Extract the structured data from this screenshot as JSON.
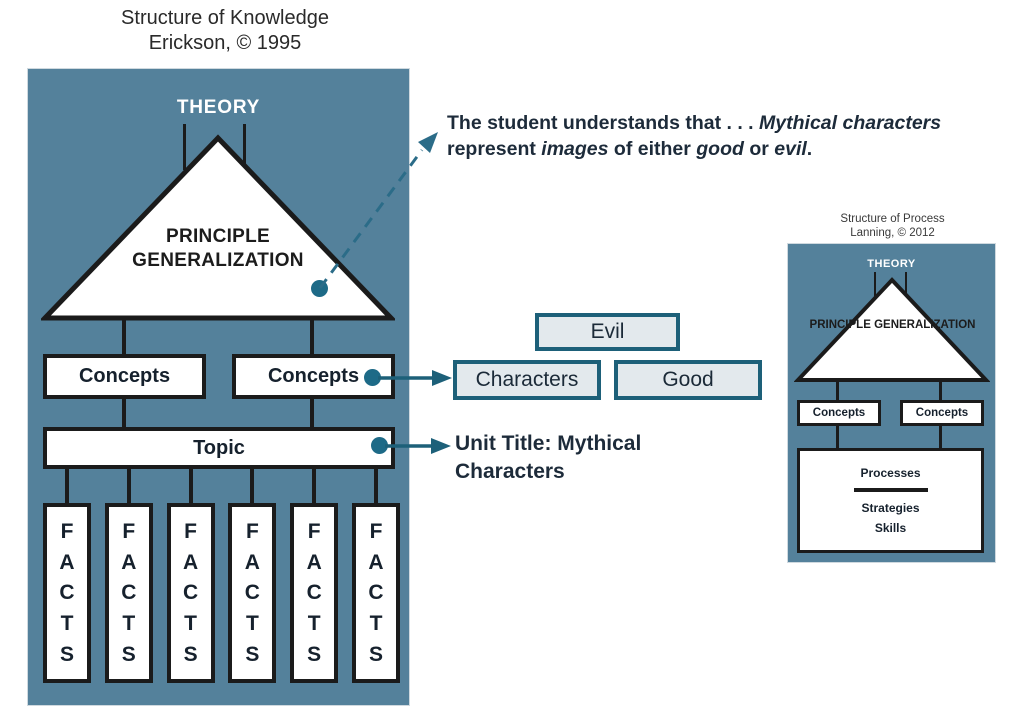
{
  "knowledge_panel": {
    "title_line1": "Structure of Knowledge",
    "title_line2": "Erickson, © 1995",
    "theory_label": "THEORY",
    "principle_line1": "PRINCIPLE",
    "principle_line2": "GENERALIZATION",
    "concepts_left": "Concepts",
    "concepts_right": "Concepts",
    "topic": "Topic",
    "facts_label": "FACTS",
    "facts_letters": [
      "F",
      "A",
      "C",
      "T",
      "S"
    ],
    "facts_column_count": 6
  },
  "annotations": {
    "generalization_note": {
      "segments": [
        {
          "text": "The student understands that . . . ",
          "italic": false
        },
        {
          "text": "Mythical characters",
          "italic": true
        },
        {
          "text": " represent ",
          "italic": false
        },
        {
          "text": "images",
          "italic": true
        },
        {
          "text": " of either ",
          "italic": false
        },
        {
          "text": "good",
          "italic": true
        },
        {
          "text": " or ",
          "italic": false
        },
        {
          "text": "evil",
          "italic": true
        },
        {
          "text": ".",
          "italic": false
        }
      ],
      "plain_text": "The student understands that . . . Mythical characters represent images of either good or evil."
    },
    "unit_title_note": "Unit Title: Mythical Characters"
  },
  "concept_boxes": {
    "evil": "Evil",
    "characters": "Characters",
    "good": "Good"
  },
  "process_panel": {
    "title_line1": "Structure of Process",
    "title_line2": "Lanning, © 2012",
    "theory_label": "THEORY",
    "principle_line1": "PRINCIPLE",
    "principle_line2": "GENERALIZATION",
    "concepts_left": "Concepts",
    "concepts_right": "Concepts",
    "processes": "Processes",
    "strategies": "Strategies",
    "skills": "Skills"
  },
  "colors": {
    "panel_blue": "#54819b",
    "teal_accent": "#1d6079",
    "teal_dot": "#1d6a87",
    "box_fill": "#e3e9ed",
    "outline_black": "#1b1b1b",
    "text_navy": "#1d2b3a"
  }
}
